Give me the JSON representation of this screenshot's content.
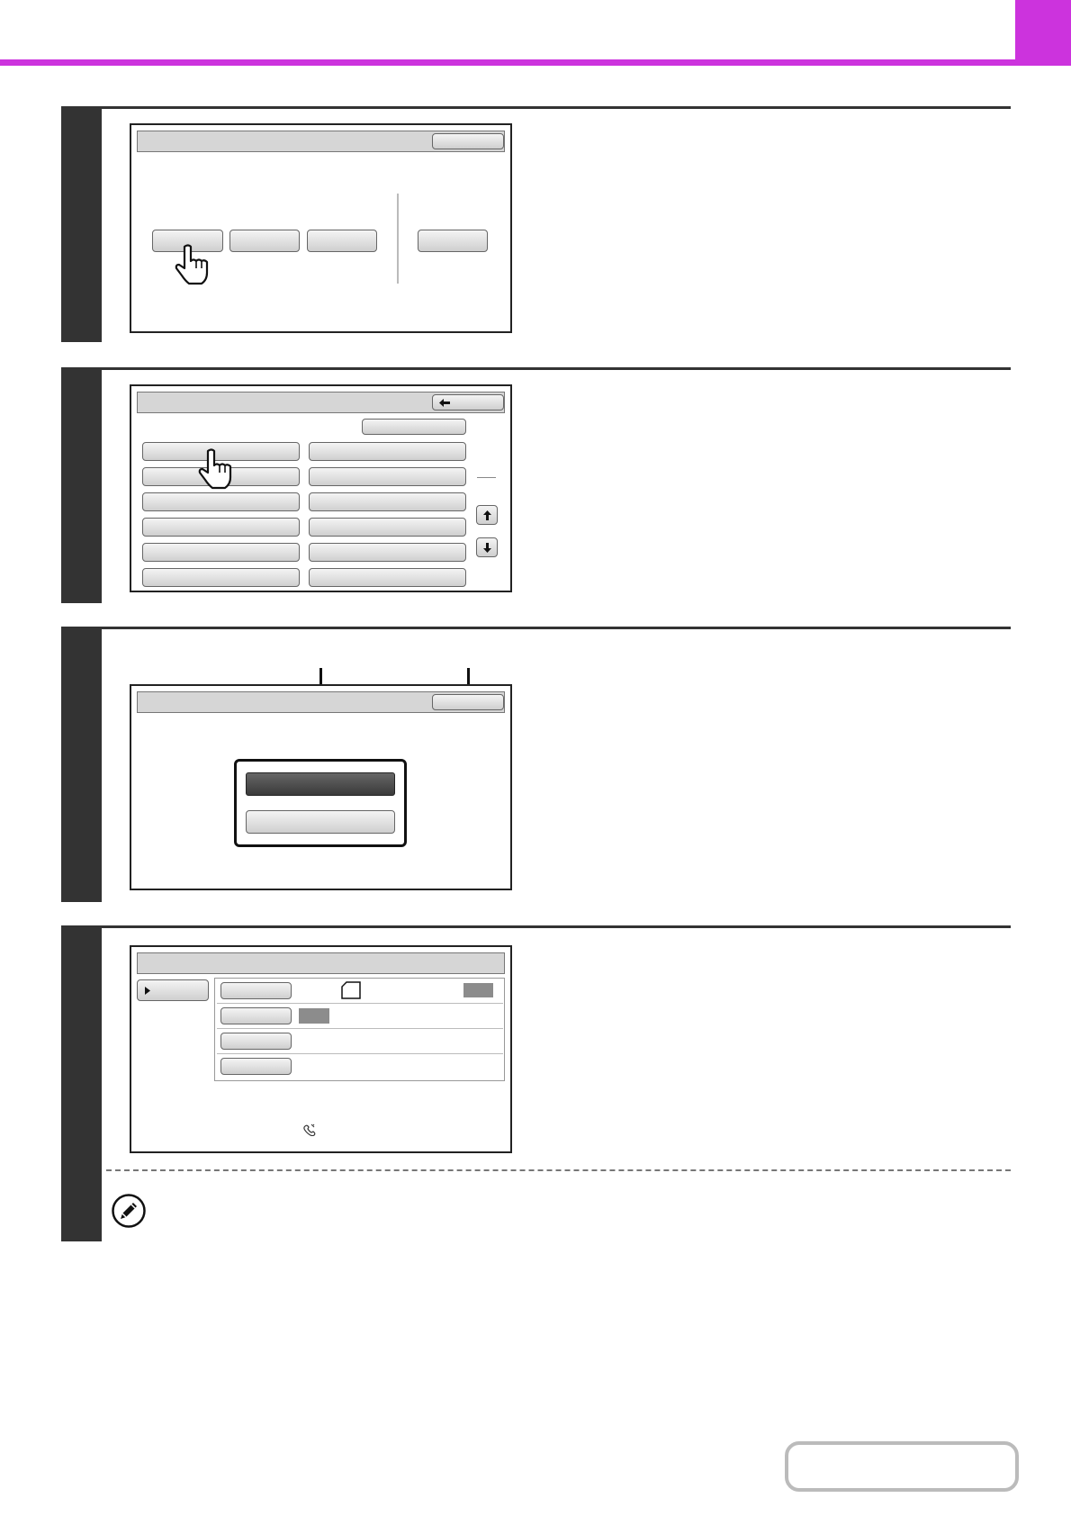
{
  "icons": {
    "pointer": "hand-pointer-icon",
    "back": "arrow-left-icon",
    "up": "arrow-up-icon",
    "down": "arrow-down-icon",
    "note": "pencil-note-icon",
    "paper": "paper-orientation-icon",
    "sender": "fax-sender-icon",
    "expand": "triangle-right-icon"
  },
  "colors": {
    "accent": "#cc33dd",
    "step_bar": "#333333"
  },
  "steps": [
    {
      "panel": "step1-screen"
    },
    {
      "panel": "step2-screen"
    },
    {
      "panel": "step3-screen"
    },
    {
      "panel": "step4-screen"
    }
  ]
}
